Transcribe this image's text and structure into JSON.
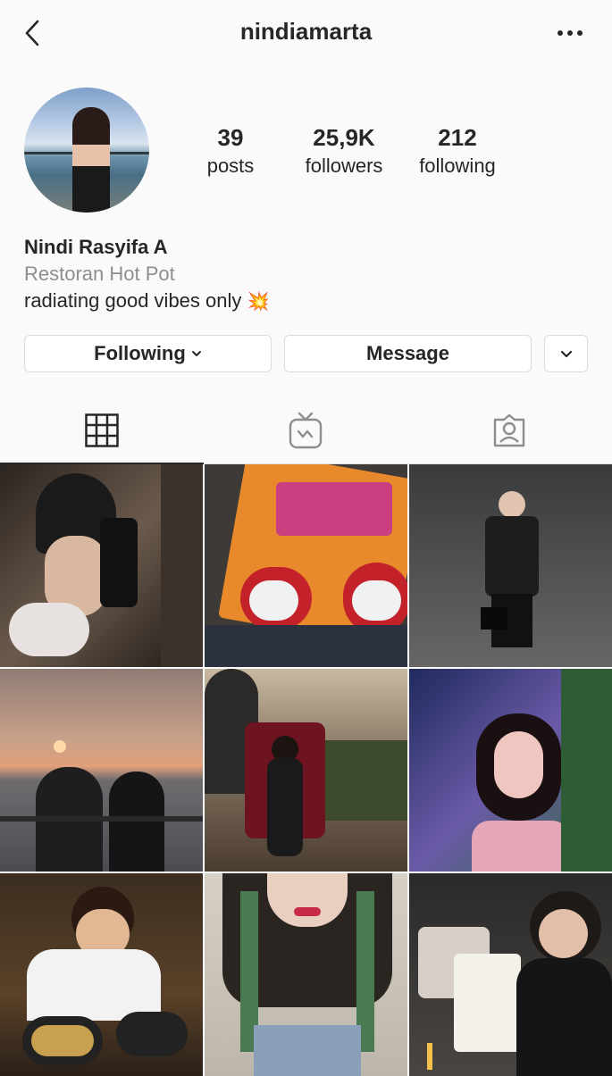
{
  "header": {
    "username": "nindiamarta",
    "back_icon": "chevron-left-icon",
    "more_icon": "more-horizontal-icon"
  },
  "profile": {
    "posts_count": "39",
    "posts_label": "posts",
    "followers_count": "25,9K",
    "followers_label": "followers",
    "following_count": "212",
    "following_label": "following",
    "full_name": "Nindi Rasyifa A",
    "category": "Restoran Hot Pot",
    "bio": "radiating good vibes only",
    "bio_emoji": "💥"
  },
  "actions": {
    "following_label": "Following",
    "message_label": "Message"
  },
  "tabs": [
    {
      "icon": "grid-icon",
      "active": true
    },
    {
      "icon": "igtv-icon",
      "active": false
    },
    {
      "icon": "tagged-icon",
      "active": false
    }
  ],
  "colors": {
    "background": "#fafafa",
    "text": "#262626",
    "secondary_text": "#8e8e8e",
    "border": "#dbdbdb"
  }
}
